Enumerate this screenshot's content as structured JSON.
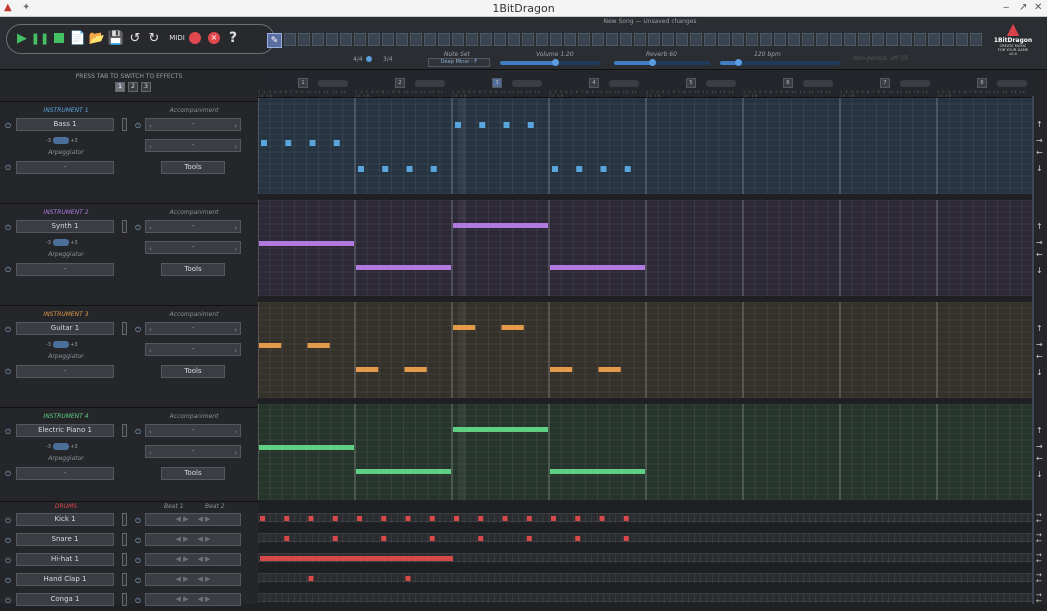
{
  "window": {
    "title": "1BitDragon"
  },
  "song": {
    "title": "New Song — Unsaved changes"
  },
  "transport": {
    "icons": [
      "play-icon",
      "pause-icon",
      "stop-icon",
      "new-file-icon",
      "open-folder-icon",
      "save-icon",
      "undo-icon",
      "redo-icon"
    ],
    "midi_label": "MIDI",
    "help_label": "?"
  },
  "top": {
    "time_sig_a": "4/4",
    "time_sig_b": "3/4",
    "note_set_label": "Note Set",
    "note_set_value": "Deep Minor - F",
    "volume_label": "Volume 1.20",
    "volume_value": 0.55,
    "reverb_label": "Reverb 60",
    "reverb_value": 0.4,
    "bpm_label": "120 bpm",
    "bpm_value": 0.15,
    "hint": "Non-period: off (0)",
    "logo_title": "1BitDragon",
    "logo_line1": "CREATE MUSIC",
    "logo_line2": "FOR YOUR GAME",
    "logo_version": "v0.0"
  },
  "left": {
    "press_text": "PRESS TAB TO SWITCH TO EFFECTS",
    "fx_tabs": [
      "1",
      "2",
      "3"
    ],
    "accompaniment_label": "Accompaniment",
    "arpeggiator_label": "Arpeggiator",
    "tools_label": "Tools",
    "dash": "-",
    "stepper_minus": "-3",
    "stepper_plus": "+3",
    "instruments": [
      {
        "label": "INSTRUMENT 1",
        "name": "Bass 1",
        "color": "#5aa6dc"
      },
      {
        "label": "INSTRUMENT 2",
        "name": "Synth 1",
        "color": "#b07ae0"
      },
      {
        "label": "INSTRUMENT 3",
        "name": "Guitar 1",
        "color": "#e39a4a"
      },
      {
        "label": "INSTRUMENT 4",
        "name": "Electric Piano 1",
        "color": "#5fcf84"
      }
    ],
    "drums": {
      "label": "DRUMS",
      "beat1": "Beat 1",
      "beat2": "Beat 2",
      "color": "#d84a4a",
      "items": [
        "Kick 1",
        "Snare 1",
        "Hi-hat 1",
        "Hand Clap 1",
        "Conga 1"
      ]
    }
  },
  "grid": {
    "bar_numbers": [
      "1",
      "2",
      "3",
      "4",
      "5",
      "6",
      "7",
      "8"
    ],
    "current_bar": 3,
    "bar_sublabel": "1 2 3 4 5 6 7 8 9 10 11 12 13 14 15 16"
  },
  "colors": {
    "bass_bg": "#263341",
    "synth_bg": "#2c2836",
    "guitar_bg": "#34302a",
    "piano_bg": "#26352c",
    "accent": "#5b9de0"
  }
}
